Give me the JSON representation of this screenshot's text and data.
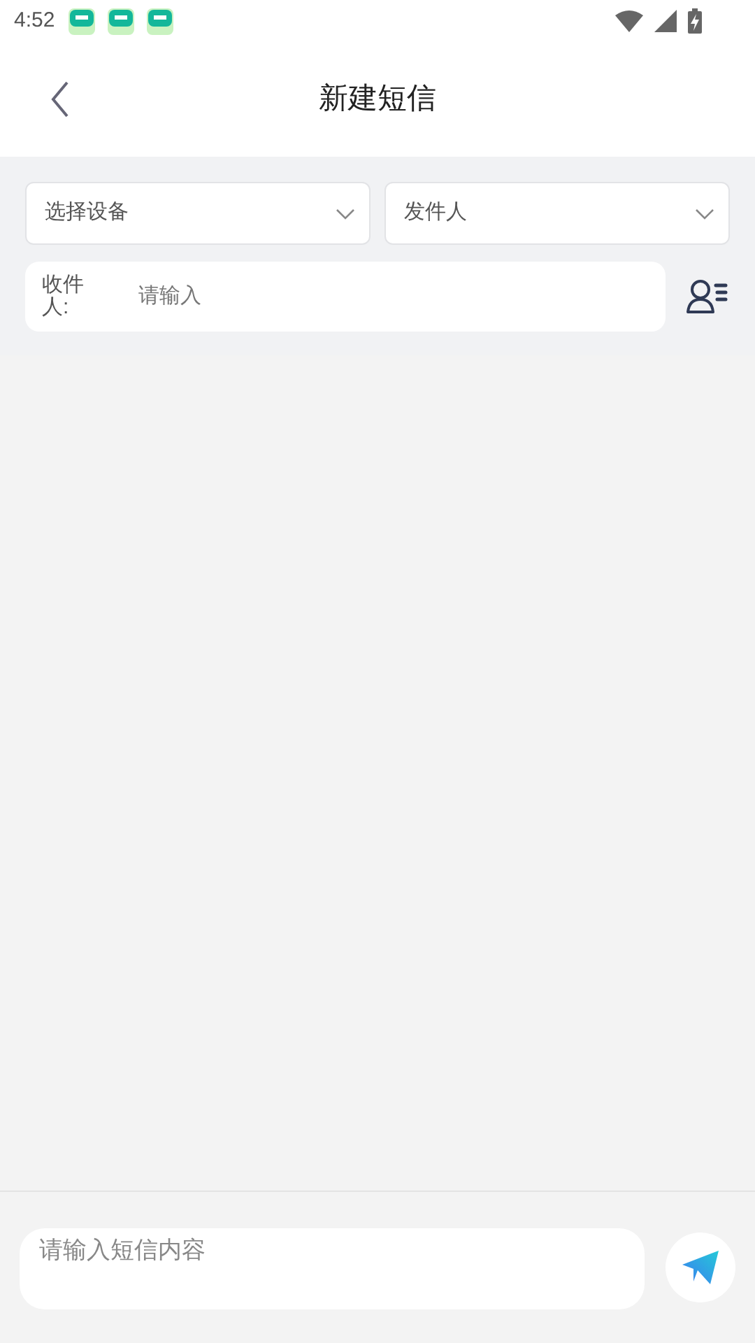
{
  "status_bar": {
    "time": "4:52"
  },
  "header": {
    "title": "新建短信"
  },
  "selects": [
    {
      "label": "选择设备"
    },
    {
      "label": "发件人"
    }
  ],
  "recipient": {
    "label": "收件人:",
    "placeholder": "请输入"
  },
  "composer": {
    "placeholder": "请输入短信内容"
  }
}
